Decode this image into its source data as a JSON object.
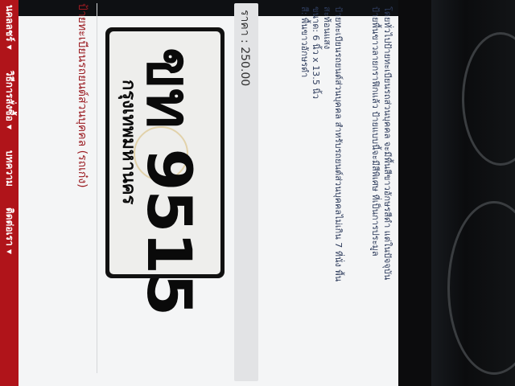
{
  "nav": [
    "นคลลชร์ ▾",
    "วิธีการสั่งซื้อ ▾",
    "บทความ",
    "ติดต่อเรา ▾"
  ],
  "product": {
    "title": "ป้ายทะเบียนรถยนต์ส่วนบุคคล (รถเก๋ง)",
    "plate_number": "ขท 9515",
    "plate_province": "กรุงเทพมหานคร",
    "price": "ราคา : 250.00"
  },
  "specs": [
    "ป้ายทะเบียนรถยนต์ส่วนบุคคล สำหรับรถยนต์ส่วนบุคคลไม่เกิน 7 ที่นั่ง พื้น",
    "สะท้อนแสง",
    "ขนาด: 6 นิ้ว x 13.5 นิ้ว",
    "สี: พื้นขาวอักษรดำ"
  ],
  "notes": [
    "โดยทั่วไปป้ายทะเบียนรถส่วนบุคคล จะมีพื้นสีขาวอักษรสีดำ แต่ในปัจจุบัน",
    "ป้ายพื้นขาวลายกราฟิกแล้ว ป้ายแบบนี้จะมีสีพิเศษ ที่เป็นการประมูล"
  ]
}
